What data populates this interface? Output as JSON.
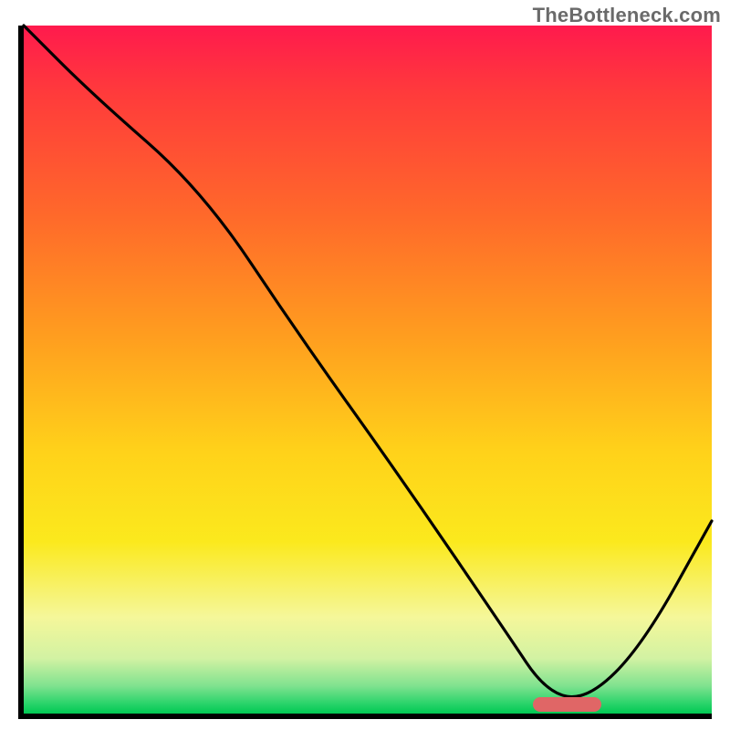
{
  "watermark": {
    "text": "TheBottleneck.com"
  },
  "chart_data": {
    "type": "line",
    "title": "",
    "xlabel": "",
    "ylabel": "",
    "xlim": [
      0,
      100
    ],
    "ylim": [
      0,
      100
    ],
    "series": [
      {
        "name": "bottleneck-curve",
        "x": [
          0,
          10,
          26,
          40,
          55,
          70,
          76,
          82,
          90,
          100
        ],
        "y": [
          100,
          90,
          76,
          55,
          34,
          12,
          3,
          2,
          10,
          28
        ]
      }
    ],
    "marker": {
      "name": "optimal-range",
      "x_start": 74,
      "x_end": 84,
      "y": 1.3,
      "color": "#e06666"
    },
    "gradient": {
      "top": "#ff1a4d",
      "mid_upper": "#ff9d1f",
      "mid": "#ffd21a",
      "mid_lower": "#f5f79a",
      "bottom": "#00c853"
    }
  }
}
